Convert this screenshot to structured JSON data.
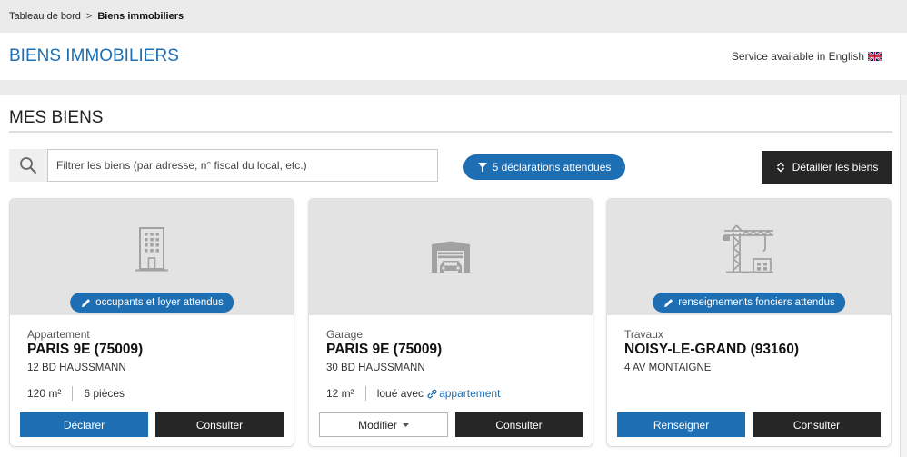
{
  "breadcrumb": {
    "home": "Tableau de bord",
    "separator": ">",
    "current": "Biens immobiliers"
  },
  "header": {
    "title": "BIENS IMMOBILIERS",
    "language_link": "Service available in English",
    "language_icon": "uk-flag-icon"
  },
  "section": {
    "title": "MES BIENS"
  },
  "toolbar": {
    "search_icon": "search-icon",
    "search_placeholder": "Filtrer les biens (par adresse, n° fiscal du local, etc.)",
    "filter_icon": "filter-icon",
    "filter_label": "5 déclarations attendues",
    "detail_icon": "expand-collapse-icon",
    "detail_label": "Détailler les biens"
  },
  "properties": [
    {
      "illustration": "building-icon",
      "status_icon": "pencil-icon",
      "status_pill": "occupants et loyer attendus",
      "type": "Appartement",
      "city": "PARIS 9E (75009)",
      "address": "12 BD HAUSSMANN",
      "surface": "120 m²",
      "rooms": "6 pièces",
      "primary_action": "Déclarer",
      "secondary_action": "Consulter"
    },
    {
      "illustration": "garage-icon",
      "type": "Garage",
      "city": "PARIS 9E (75009)",
      "address": "30 BD HAUSSMANN",
      "surface": "12 m²",
      "rental_note": "loué avec",
      "rental_link_icon": "link-icon",
      "rental_link": "appartement",
      "primary_action": "Modifier",
      "primary_action_icon": "caret-down-icon",
      "secondary_action": "Consulter"
    },
    {
      "illustration": "crane-icon",
      "status_icon": "pencil-icon",
      "status_pill": "renseignements fonciers attendus",
      "type": "Travaux",
      "city": "NOISY-LE-GRAND (93160)",
      "address": "4 AV MONTAIGNE",
      "primary_action": "Renseigner",
      "secondary_action": "Consulter"
    }
  ],
  "colors": {
    "brand_blue": "#1d6eb3",
    "dark_button": "#262626",
    "band_gray": "#ebebeb",
    "card_header_gray": "#e3e3e3"
  }
}
